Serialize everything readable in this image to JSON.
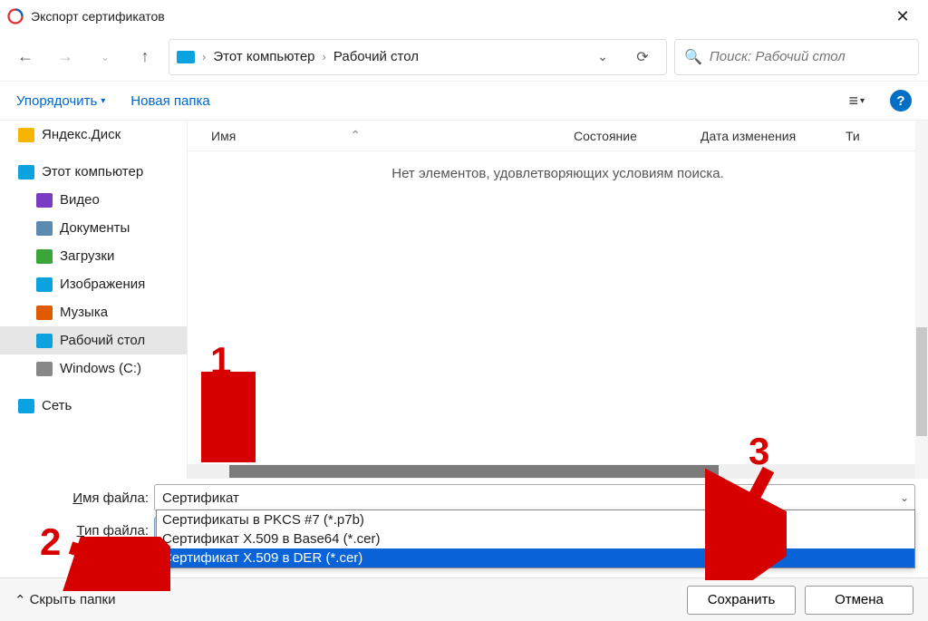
{
  "title": "Экспорт сертификатов",
  "breadcrumbs": [
    "Этот компьютер",
    "Рабочий стол"
  ],
  "search": {
    "placeholder": "Поиск: Рабочий стол"
  },
  "toolbar": {
    "organize": "Упорядочить",
    "new_folder": "Новая папка"
  },
  "columns": {
    "name": "Имя",
    "state": "Состояние",
    "modified": "Дата изменения",
    "type": "Ти"
  },
  "empty_message": "Нет элементов, удовлетворяющих условиям поиска.",
  "sidebar": {
    "items": [
      {
        "label": "Яндекс.Диск",
        "icon": "yadisk"
      },
      {
        "label": "Этот компьютер",
        "icon": "pc"
      },
      {
        "label": "Видео",
        "icon": "video",
        "indent": true
      },
      {
        "label": "Документы",
        "icon": "doc",
        "indent": true
      },
      {
        "label": "Загрузки",
        "icon": "download",
        "indent": true
      },
      {
        "label": "Изображения",
        "icon": "image",
        "indent": true
      },
      {
        "label": "Музыка",
        "icon": "music",
        "indent": true
      },
      {
        "label": "Рабочий стол",
        "icon": "desktop",
        "indent": true,
        "selected": true
      },
      {
        "label": "Windows (C:)",
        "icon": "disk",
        "indent": true
      },
      {
        "label": "Сеть",
        "icon": "network"
      }
    ]
  },
  "fields": {
    "filename_label": "Имя файла:",
    "filename_value": "Сертификат",
    "filetype_label": "Тип файла:",
    "filetype_value": "Сертификаты в PKCS #7 (*.p7b)",
    "filetype_options": [
      "Сертификаты в PKCS #7 (*.p7b)",
      "Сертификат X.509 в Base64 (*.cer)",
      "Сертификат X.509 в DER (*.cer)"
    ],
    "filetype_selected_index": 2
  },
  "footer": {
    "hide_folders": "Скрыть папки",
    "save": "Сохранить",
    "cancel": "Отмена"
  },
  "annotations": {
    "1": "1",
    "2": "2",
    "3": "3"
  },
  "icon_colors": {
    "yadisk": "#f7b500",
    "pc": "#0aa3e0",
    "video": "#7a3bc4",
    "doc": "#5b8bb0",
    "download": "#3aa63a",
    "image": "#0aa3e0",
    "music": "#e05a00",
    "desktop": "#0aa3e0",
    "disk": "#888",
    "network": "#0aa3e0"
  }
}
